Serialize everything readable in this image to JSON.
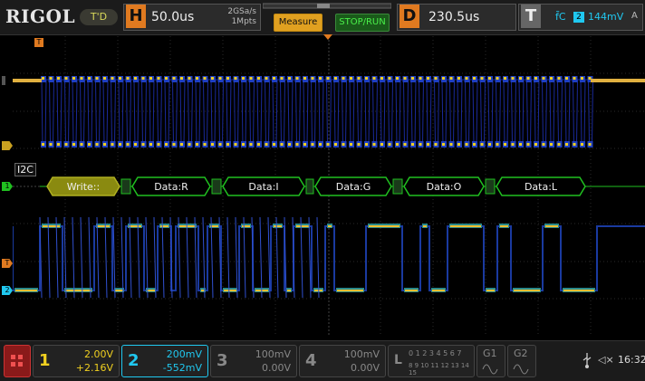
{
  "brand": "RIGOL",
  "trigger_status": "T'D",
  "horizontal": {
    "letter": "H",
    "timebase": "50.0us",
    "sample_rate": "2GSa/s",
    "memory_depth": "1Mpts"
  },
  "measure_button": "Measure",
  "stop_run_button": "STOP/RUN",
  "delay": {
    "letter": "D",
    "value": "230.5us"
  },
  "trigger": {
    "letter": "T",
    "slope_symbol": "f̄C",
    "source": "2",
    "level": "144mV",
    "mode": "A"
  },
  "decode": {
    "bus": "I2C",
    "packets": [
      "Write::",
      "Data:R",
      "Data:I",
      "Data:G",
      "Data:O",
      "Data:L"
    ]
  },
  "channels": [
    {
      "num": "1",
      "scale": "2.00V",
      "offset": "+2.16V",
      "color": "#f0d020"
    },
    {
      "num": "2",
      "scale": "200mV",
      "offset": "-552mV",
      "color": "#20c8f0"
    },
    {
      "num": "3",
      "scale": "100mV",
      "offset": "0.00V",
      "color": "#888888"
    },
    {
      "num": "4",
      "scale": "100mV",
      "offset": "0.00V",
      "color": "#888888"
    }
  ],
  "logic": {
    "letter": "L",
    "row1": "0 1 2 3 4 5 6 7",
    "row2": "8 9 10 11 12 13 14 15"
  },
  "generators": [
    "G1",
    "G2"
  ],
  "marker_labels": {
    "ch1": "1",
    "ch2": "2",
    "trig": "T",
    "bus": "1"
  },
  "time": "16:32",
  "volume_icon_text": "◁×"
}
